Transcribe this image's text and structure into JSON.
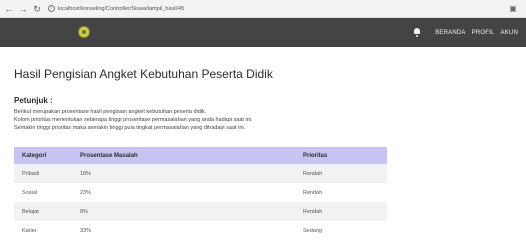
{
  "browser": {
    "back_icon": "arrow-left",
    "forward_icon": "arrow-right",
    "reload_icon": "reload",
    "url": "localhost/konseling/Controller/Siswa/tampil_hasil/45"
  },
  "navbar": {
    "logo": "school-emblem",
    "links": [
      "BERANDA",
      "PROFIL",
      "AKUN"
    ]
  },
  "page": {
    "title": "Hasil Pengisian Angket Kebutuhan Peserta Didik"
  },
  "instructions": {
    "title": "Petunjuk :",
    "lines": [
      "Berikut merupakan prosentase hasil pengisian angket kebutuhan peserta didik.",
      "Kolom prioritas menentukan seberapa tinggi prosentase permasalahan yang anda hadapi saat ini.",
      "Semakin tinggi prioritas maka semakin tinggi pula tingkat permasalahan yang dihadapi saat ini."
    ]
  },
  "table": {
    "headers": [
      "Kategori",
      "Prosentase Masalah",
      "Prioritas"
    ],
    "rows": [
      [
        "Pribadi",
        "18%",
        "Rendah"
      ],
      [
        "Sosial",
        "23%",
        "Rendah"
      ],
      [
        "Belajar",
        "8%",
        "Rendah"
      ],
      [
        "Karier",
        "33%",
        "Sedang"
      ]
    ]
  },
  "colors": {
    "navbar_bg": "#444444",
    "table_header_bg": "#c7c3f2",
    "row_alt_bg": "#f2f2f2"
  }
}
